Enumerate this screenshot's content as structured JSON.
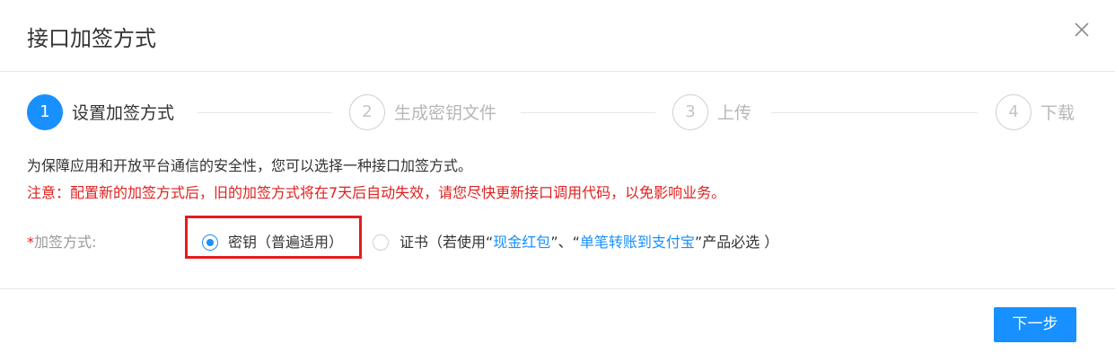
{
  "dialog": {
    "title": "接口加签方式",
    "close_icon": "close-icon"
  },
  "steps": [
    {
      "number": "1",
      "label": "设置加签方式",
      "active": true
    },
    {
      "number": "2",
      "label": "生成密钥文件",
      "active": false
    },
    {
      "number": "3",
      "label": "上传",
      "active": false
    },
    {
      "number": "4",
      "label": "下载",
      "active": false
    }
  ],
  "content": {
    "description": "为保障应用和开放平台通信的安全性，您可以选择一种接口加签方式。",
    "notice": "注意：配置新的加签方式后，旧的加签方式将在7天后自动失效，请您尽快更新接口调用代码，以免影响业务。"
  },
  "form": {
    "required_mark": "*",
    "label": "加签方式:",
    "options": [
      {
        "label": "密钥（普遍适用）",
        "checked": true
      },
      {
        "prefix": "证书（若使用“",
        "link1": "现金红包",
        "middle": "”、“",
        "link2": "单笔转账到支付宝",
        "suffix": "”产品必选 ）",
        "checked": false
      }
    ]
  },
  "footer": {
    "next_label": "下一步"
  },
  "colors": {
    "primary": "#1890ff",
    "warning": "#e02020",
    "highlight_border": "#e51c1c"
  }
}
